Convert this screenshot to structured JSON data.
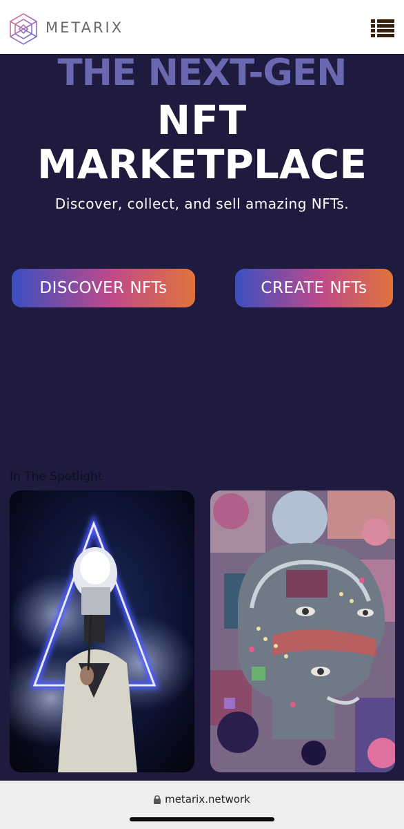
{
  "header": {
    "brand": "METARIX",
    "logo_icon": "metarix-logo-icon",
    "menu_icon": "menu-icon"
  },
  "hero": {
    "line1": "THE NEXT-GEN",
    "line2": "NFT",
    "line3": "MARKETPLACE",
    "subtitle": "Discover, collect, and sell amazing NFTs."
  },
  "buttons": {
    "discover": "DISCOVER NFTs",
    "create": "CREATE NFTs"
  },
  "spotlight": {
    "title": "In The Spotlight"
  },
  "browser": {
    "url": "metarix.network",
    "lock_icon": "lock-icon"
  },
  "colors": {
    "background": "#1e1b3f",
    "accent_text": "#6a68b0",
    "gradient_start": "#3a4fc0",
    "gradient_mid": "#c04a8a",
    "gradient_end": "#e0743c"
  }
}
